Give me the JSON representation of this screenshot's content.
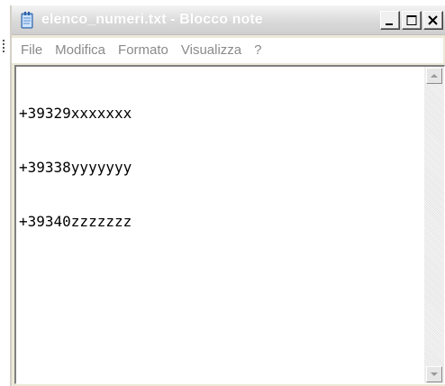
{
  "window": {
    "title": "elenco_numeri.txt - Blocco note",
    "buttons": {
      "minimize_icon": "minimize-icon",
      "maximize_icon": "maximize-icon",
      "close_icon": "close-icon"
    }
  },
  "menubar": {
    "items": [
      {
        "label": "File"
      },
      {
        "label": "Modifica"
      },
      {
        "label": "Formato"
      },
      {
        "label": "Visualizza"
      },
      {
        "label": "?"
      }
    ]
  },
  "editor": {
    "lines": [
      "+39329xxxxxxx",
      "+39338yyyyyyy",
      "+39340zzzzzzz"
    ]
  },
  "colors": {
    "titlebar": "#dadada",
    "menu_text": "#8a8a8a",
    "window_face": "#ece9d8",
    "editor_bg": "#ffffff"
  },
  "icons": {
    "app": "notepad-icon",
    "scroll_up": "arrow-up-icon",
    "scroll_down": "arrow-down-icon"
  }
}
